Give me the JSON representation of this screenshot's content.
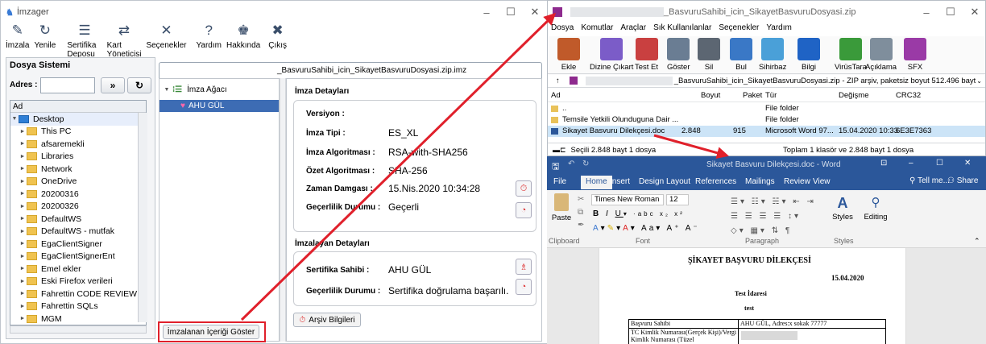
{
  "imzager": {
    "title": "İmzager",
    "tools": [
      {
        "label": "İmzala",
        "icon": "sign-icon"
      },
      {
        "label": "Yenile",
        "icon": "refresh-icon"
      },
      {
        "label": "Sertifika Deposu",
        "icon": "certificate-store-icon"
      },
      {
        "label": "Kart Yöneticisi",
        "icon": "card-manager-icon"
      },
      {
        "label": "Seçenekler",
        "icon": "options-icon"
      },
      {
        "label": "Yardım",
        "icon": "help-icon"
      },
      {
        "label": "Hakkında",
        "icon": "about-icon"
      },
      {
        "label": "Çıkış",
        "icon": "exit-icon"
      }
    ],
    "fs_title": "Dosya Sistemi",
    "adres_label": "Adres :",
    "tree_header": "Ad",
    "tree": [
      "Desktop",
      "This PC",
      "afsaremekli",
      "Libraries",
      "Network",
      "OneDrive",
      "20200316",
      "20200326",
      "DefaultWS",
      "DefaultWS - mutfak",
      "EgaClientSigner",
      "EgaClientSignerEnt",
      "Emel ekler",
      "Eski Firefox verileri",
      "Fahrettin CODE REVIEW",
      "Fahrettin SQLs",
      "MGM"
    ],
    "file_tab": "_BasvuruSahibi_icin_SikayetBasvuruDosyasi.zip.imz",
    "sig_tree_root": "İmza Ağacı",
    "sig_tree_item": "AHU GÜL",
    "show_content_button": "İmzalanan İçeriği Göster",
    "archive_button": "Arşiv Bilgileri",
    "imza_detay_title": "İmza Detayları",
    "imza_fields": [
      {
        "label": "Versiyon :",
        "value": ""
      },
      {
        "label": "İmza Tipi :",
        "value": "ES_XL"
      },
      {
        "label": "İmza Algoritması :",
        "value": "RSA-with-SHA256"
      },
      {
        "label": "Özet Algoritması :",
        "value": "SHA-256"
      },
      {
        "label": "Zaman Damgası :",
        "value": "15.Nis.2020 10:34:28"
      },
      {
        "label": "Geçerlilik Durumu :",
        "value": "Geçerli"
      }
    ],
    "imzalayan_title": "İmzalayan Detayları",
    "imzalayan_fields": [
      {
        "label": "Sertifika Sahibi :",
        "value": "AHU GÜL"
      },
      {
        "label": "Geçerlilik Durumu :",
        "value": "Sertifika doğrulama başarılı."
      }
    ]
  },
  "zip": {
    "title": "_BasvuruSahibi_icin_SikayetBasvuruDosyasi.zip",
    "menu": [
      "Dosya",
      "Komutlar",
      "Araçlar",
      "Sık Kullanılanlar",
      "Seçenekler",
      "Yardım"
    ],
    "tools": [
      "Ekle",
      "Dizine Çıkart",
      "Test Et",
      "Göster",
      "Sil",
      "Bul",
      "Sihirbaz",
      "Bilgi",
      "VirüsTara",
      "Açıklama",
      "SFX"
    ],
    "path": "_BasvuruSahibi_icin_SikayetBasvuruDosyasi.zip - ZIP arşiv, paketsiz boyut 512.496 bayt",
    "columns": [
      "Ad",
      "Boyut",
      "Paket",
      "Tür",
      "Değişme",
      "CRC32"
    ],
    "rows": [
      {
        "name": "..",
        "size": "",
        "packed": "",
        "type": "File folder",
        "modified": "",
        "crc": ""
      },
      {
        "name": "Temsile Yetkili Olunduguna Dair ...",
        "size": "",
        "packed": "",
        "type": "File folder",
        "modified": "",
        "crc": ""
      },
      {
        "name": "Sikayet Basvuru Dilekçesi.doc",
        "size": "2.848",
        "packed": "915",
        "type": "Microsoft Word 97...",
        "modified": "15.04.2020 10:33",
        "crc": "6E3E7363"
      }
    ],
    "status_left": "Seçili 2.848 bayt 1 dosya",
    "status_right": "Toplam 1 klasör ve 2.848 bayt 1 dosya"
  },
  "word": {
    "title": "Sikayet Basvuru Dilekçesi.doc - Word",
    "tabs": [
      "File",
      "Home",
      "Insert",
      "Design",
      "Layout",
      "References",
      "Mailings",
      "Review",
      "View"
    ],
    "tell_me": "Tell me...",
    "share": "Share",
    "font_name": "Times New Roman",
    "font_size": "12",
    "paste": "Paste",
    "styles": "Styles",
    "editing": "Editing",
    "groups": [
      "Clipboard",
      "Font",
      "Paragraph",
      "Styles"
    ],
    "doc_title": "ŞİKAYET BAŞVURU DİLEKÇESİ",
    "doc_date": "15.04.2020",
    "doc_to": "Test İdaresi",
    "doc_sub": "test",
    "table": [
      [
        "Başvuru Sahibi",
        "AHU GÜL, Adres:x sokak 77777"
      ],
      [
        "TC Kimlik Numarası(Gerçek Kişi)/Vergi Kimlik Numarası (Tüzel",
        ""
      ]
    ]
  },
  "colors": {
    "arrow": "#e0202b",
    "word_blue": "#2b579a",
    "selected": "#3d6cb4"
  }
}
